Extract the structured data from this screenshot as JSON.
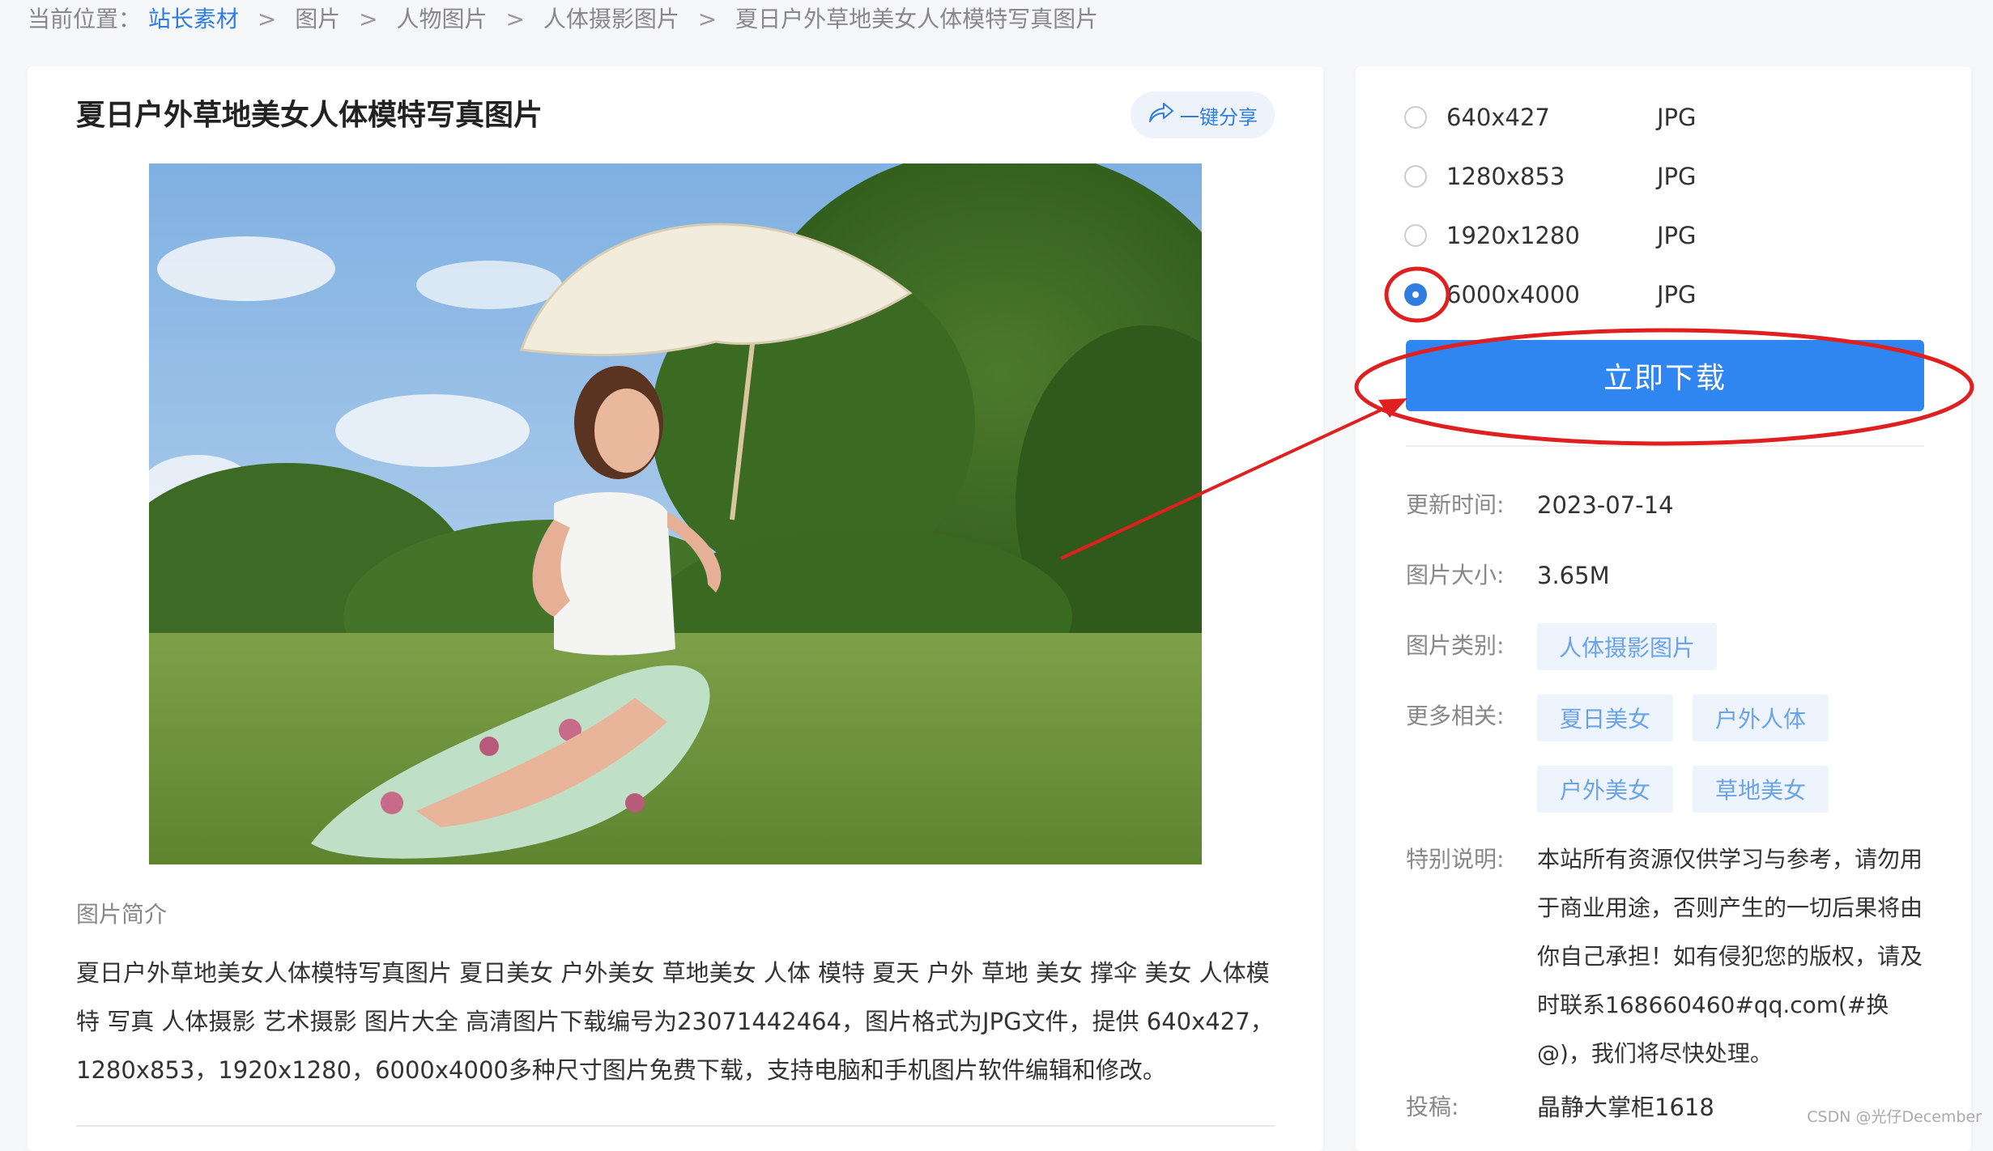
{
  "breadcrumb": {
    "prefix": "当前位置：",
    "items": [
      "站长素材",
      "图片",
      "人物图片",
      "人体摄影图片",
      "夏日户外草地美女人体模特写真图片"
    ],
    "separator": ">"
  },
  "main": {
    "title": "夏日户外草地美女人体模特写真图片",
    "share_label": "一键分享",
    "intro_label": "图片简介",
    "intro_text": "夏日户外草地美女人体模特写真图片 夏日美女 户外美女 草地美女 人体 模特 夏天 户外 草地 美女 撑伞 美女 人体模特 写真 人体摄影 艺术摄影 图片大全 高清图片下载编号为23071442464，图片格式为JPG文件，提供 640x427，1280x853，1920x1280，6000x4000多种尺寸图片免费下载，支持电脑和手机图片软件编辑和修改。"
  },
  "sizes": [
    {
      "size": "640x427",
      "format": "JPG",
      "selected": false
    },
    {
      "size": "1280x853",
      "format": "JPG",
      "selected": false
    },
    {
      "size": "1920x1280",
      "format": "JPG",
      "selected": false
    },
    {
      "size": "6000x4000",
      "format": "JPG",
      "selected": true
    }
  ],
  "download_label": "立即下载",
  "meta": {
    "update_label": "更新时间:",
    "update_value": "2023-07-14",
    "size_label": "图片大小:",
    "size_value": "3.65M",
    "category_label": "图片类别:",
    "category_value": "人体摄影图片",
    "related_label": "更多相关:",
    "related": [
      "夏日美女",
      "户外人体",
      "户外美女",
      "草地美女"
    ],
    "note_label": "特别说明:",
    "note_value": "本站所有资源仅供学习与参考，请勿用于商业用途，否则产生的一切后果将由你自己承担！如有侵犯您的版权，请及时联系168660460#qq.com(#换@)，我们将尽快处理。",
    "contrib_label": "投稿:",
    "contrib_value": "晶静大掌柜1618"
  },
  "watermark": "CSDN @光仔December",
  "colors": {
    "accent": "#2f7de1",
    "button": "#2f86f0",
    "annotation": "#e02020"
  }
}
